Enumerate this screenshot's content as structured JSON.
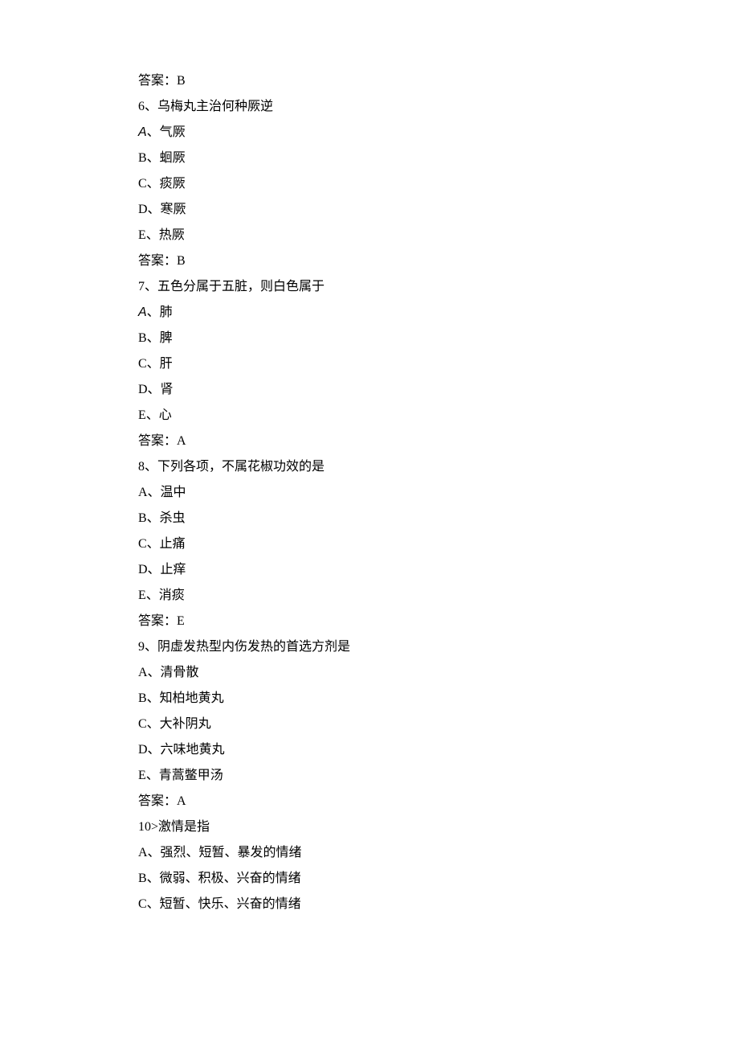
{
  "lines": [
    {
      "id": "ans5",
      "text": "答案：B"
    },
    {
      "id": "q6",
      "text": "6、乌梅丸主治何种厥逆"
    },
    {
      "id": "q6a",
      "text": "A、气厥",
      "italic_first": true
    },
    {
      "id": "q6b",
      "text": "B、蛔厥"
    },
    {
      "id": "q6c",
      "text": "C、痰厥"
    },
    {
      "id": "q6d",
      "text": "D、寒厥"
    },
    {
      "id": "q6e",
      "text": "E、热厥"
    },
    {
      "id": "ans6",
      "text": "答案：B"
    },
    {
      "id": "q7",
      "text": "7、五色分属于五脏，则白色属于"
    },
    {
      "id": "q7a",
      "text": "A、肺",
      "italic_first": true
    },
    {
      "id": "q7b",
      "text": "B、脾"
    },
    {
      "id": "q7c",
      "text": "C、肝"
    },
    {
      "id": "q7d",
      "text": "D、肾"
    },
    {
      "id": "q7e",
      "text": "E、心"
    },
    {
      "id": "ans7",
      "text": "答案：A"
    },
    {
      "id": "q8",
      "text": "8、下列各项，不属花椒功效的是"
    },
    {
      "id": "q8a",
      "text": "A、温中"
    },
    {
      "id": "q8b",
      "text": "B、杀虫"
    },
    {
      "id": "q8c",
      "text": "C、止痛"
    },
    {
      "id": "q8d",
      "text": "D、止痒"
    },
    {
      "id": "q8e",
      "text": "E、消痰"
    },
    {
      "id": "ans8",
      "text": "答案：E"
    },
    {
      "id": "q9",
      "text": "9、阴虚发热型内伤发热的首选方剂是"
    },
    {
      "id": "q9a",
      "text": "A、清骨散"
    },
    {
      "id": "q9b",
      "text": "B、知柏地黄丸"
    },
    {
      "id": "q9c",
      "text": "C、大补阴丸"
    },
    {
      "id": "q9d",
      "text": "D、六味地黄丸"
    },
    {
      "id": "q9e",
      "text": "E、青蒿鳖甲汤"
    },
    {
      "id": "ans9",
      "text": "答案：A"
    },
    {
      "id": "q10",
      "text": "10>激情是指"
    },
    {
      "id": "q10a",
      "text": "A、强烈、短暂、暴发的情绪"
    },
    {
      "id": "q10b",
      "text": "B、微弱、积极、兴奋的情绪"
    },
    {
      "id": "q10c",
      "text": "C、短暂、快乐、兴奋的情绪"
    }
  ]
}
